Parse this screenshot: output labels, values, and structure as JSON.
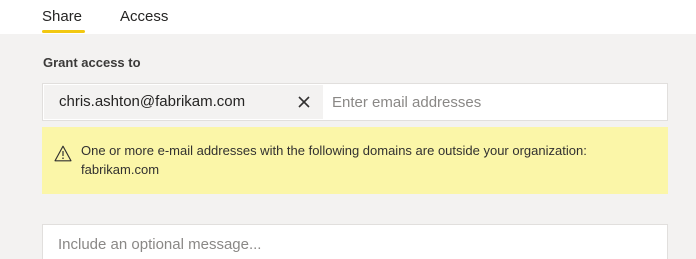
{
  "tabs": [
    {
      "label": "Share",
      "selected": true
    },
    {
      "label": "Access",
      "selected": false
    }
  ],
  "grant_access": {
    "label": "Grant access to",
    "recipients": [
      {
        "email": "chris.ashton@fabrikam.com",
        "remove_icon": "close-icon"
      }
    ],
    "placeholder": "Enter email addresses"
  },
  "warning": {
    "icon": "warning-icon",
    "text": "One or more e-mail addresses with the following domains are outside your organization: fabrikam.com"
  },
  "message": {
    "placeholder": "Include an optional message..."
  },
  "colors": {
    "accent": "#f2c811",
    "panel_bg": "#f3f2f1",
    "warning_bg": "#fbf6a8"
  }
}
